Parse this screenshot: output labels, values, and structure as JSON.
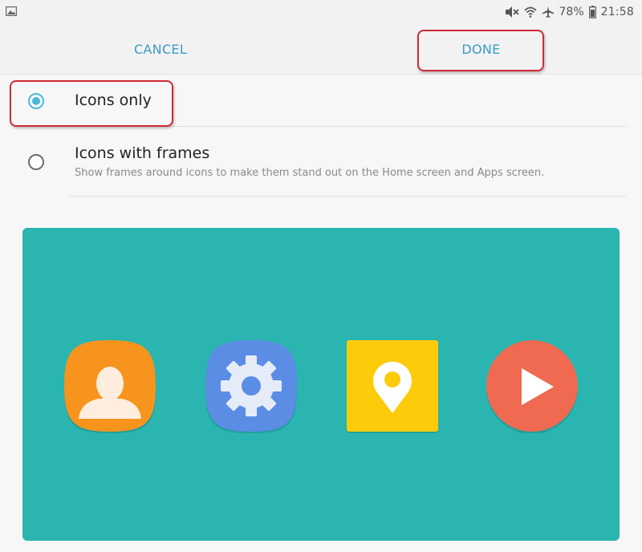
{
  "status_bar": {
    "battery_percent": "78%",
    "time": "21:58",
    "icons": [
      "gallery-icon",
      "mute-icon",
      "wifi-icon",
      "airplane-icon",
      "battery-icon"
    ]
  },
  "actions": {
    "cancel_label": "CANCEL",
    "done_label": "DONE"
  },
  "options": [
    {
      "title": "Icons only",
      "description": "",
      "selected": true
    },
    {
      "title": "Icons with frames",
      "description": "Show frames around icons to make them stand out on the Home screen and Apps screen.",
      "selected": false
    }
  ],
  "preview": {
    "background": "#2ab5b0",
    "icons": [
      {
        "name": "contacts-icon",
        "color": "#f7941d"
      },
      {
        "name": "settings-icon",
        "color": "#5b8de5"
      },
      {
        "name": "maps-icon",
        "color": "#fccc0a"
      },
      {
        "name": "video-icon",
        "color": "#f06a52"
      }
    ]
  },
  "colors": {
    "accent": "#3b9ac6",
    "radio_selected": "#4ab7dd",
    "highlight": "#cf2b36"
  }
}
